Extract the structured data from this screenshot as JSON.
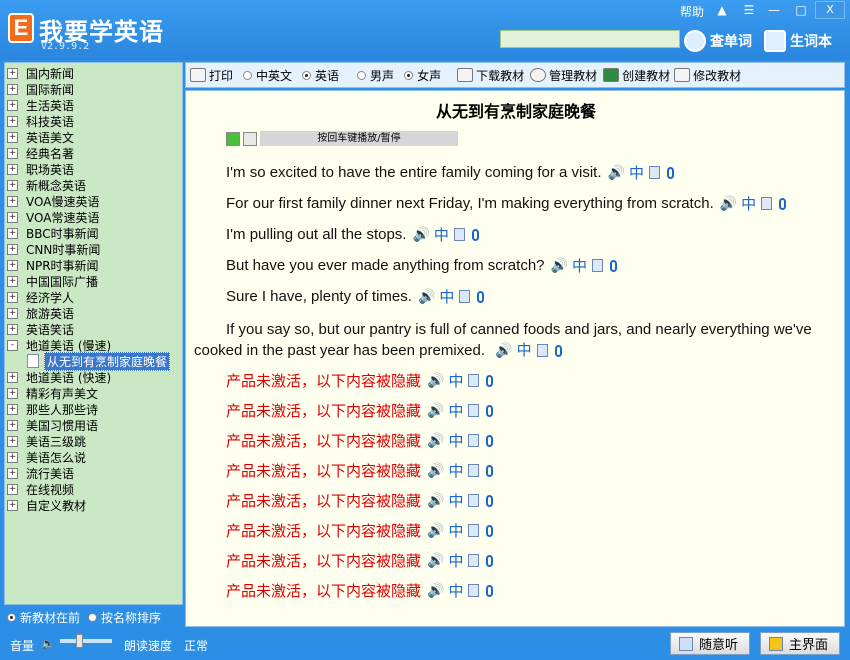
{
  "app": {
    "logo_letter": "E",
    "title": "我要学英语",
    "version": "V2.9.9.2"
  },
  "window_controls": {
    "help": "帮助",
    "close": "X"
  },
  "search": {
    "placeholder": "",
    "lookup_label": "查单词",
    "vocab_label": "生词本"
  },
  "sidebar": {
    "items": [
      {
        "label": "国内新闻"
      },
      {
        "label": "国际新闻"
      },
      {
        "label": "生活英语"
      },
      {
        "label": "科技英语"
      },
      {
        "label": "英语美文"
      },
      {
        "label": "经典名著"
      },
      {
        "label": "职场英语"
      },
      {
        "label": "新概念英语"
      },
      {
        "label": "VOA慢速英语"
      },
      {
        "label": "VOA常速英语"
      },
      {
        "label": "BBC时事新闻"
      },
      {
        "label": "CNN时事新闻"
      },
      {
        "label": "NPR时事新闻"
      },
      {
        "label": "中国国际广播"
      },
      {
        "label": "经济学人"
      },
      {
        "label": "旅游英语"
      },
      {
        "label": "英语笑话"
      },
      {
        "label": "地道美语 (慢速)"
      }
    ],
    "selected_child": "从无到有烹制家庭晚餐",
    "items_after": [
      {
        "label": "地道美语 (快速)"
      },
      {
        "label": "精彩有声美文"
      },
      {
        "label": "那些人那些诗"
      },
      {
        "label": "美国习惯用语"
      },
      {
        "label": "美语三级跳"
      },
      {
        "label": "美语怎么说"
      },
      {
        "label": "流行美语"
      },
      {
        "label": "在线视频"
      },
      {
        "label": "自定义教材"
      }
    ],
    "expand_glyph": "+",
    "sort_new_first": "新教材在前",
    "sort_by_name": "按名称排序"
  },
  "toolbar": {
    "print": "打印",
    "mode_cn_en": "中英文",
    "mode_en": "英语",
    "voice_male": "男声",
    "voice_female": "女声",
    "download": "下载教材",
    "manage": "管理教材",
    "create": "创建教材",
    "edit": "修改教材"
  },
  "article": {
    "title": "从无到有烹制家庭晚餐",
    "player_hint": "按回车键播放/暂停",
    "sentences": [
      "I'm so excited to have the entire family coming for a visit.",
      "For our first family dinner next Friday, I'm making everything from scratch.",
      "I'm pulling out all the stops.",
      "But have you ever made anything from scratch?",
      "Sure I have, plenty of times."
    ],
    "long_sentence": "If you say so, but our pantry is full of canned foods and jars, and nearly everything we've cooked in the past year has been premixed.",
    "locked_line": "产品未激活，以下内容被隐藏",
    "locked_count": 8,
    "zh_icon": "中",
    "speaker_icon": "🔊"
  },
  "statusbar": {
    "volume": "音量",
    "speed_label": "朗读速度",
    "speed_value": "正常",
    "listen_button": "随意听",
    "home_button": "主界面"
  }
}
